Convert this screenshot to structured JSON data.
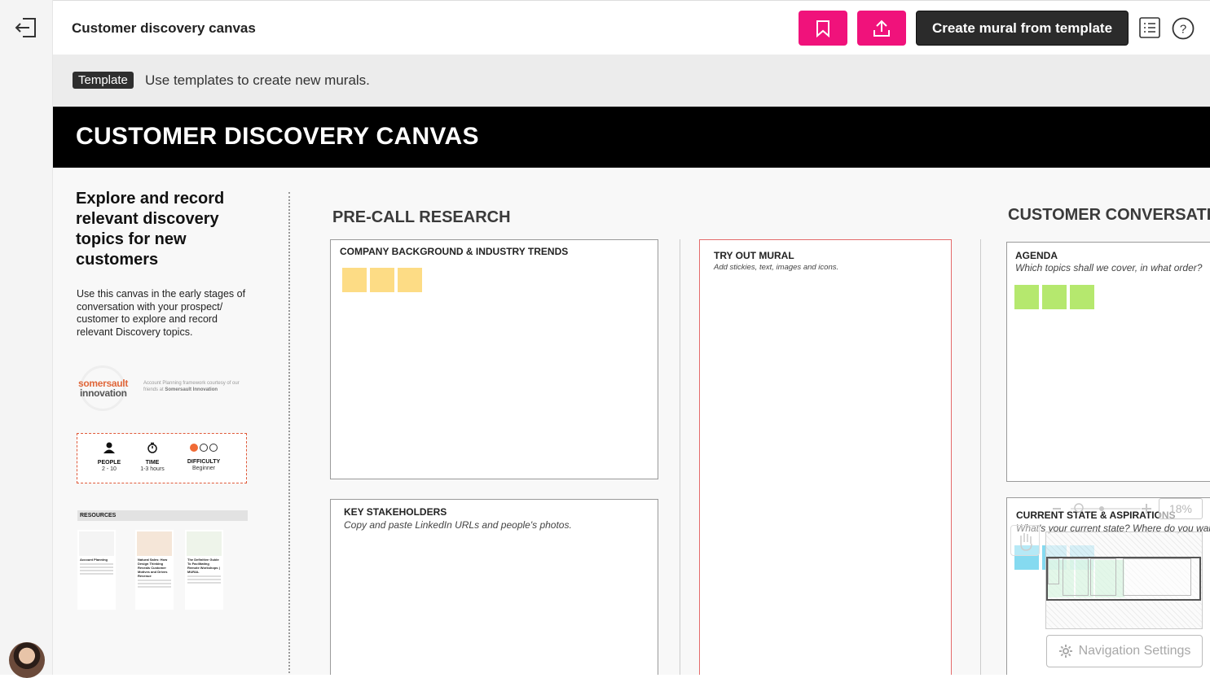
{
  "header": {
    "title": "Customer discovery canvas",
    "create_button": "Create mural from template",
    "accent_color": "#f0127b"
  },
  "banner": {
    "badge": "Template",
    "text": "Use templates to create new murals."
  },
  "canvas": {
    "title": "CUSTOMER DISCOVERY CANVAS",
    "intro_heading": "Explore and record relevant discovery topics for new customers",
    "intro_body": "Use this canvas in the early stages of conversation with your prospect/ customer to explore and record relevant Discovery topics.",
    "logo": {
      "word1": "somersault",
      "word2": "innovation"
    },
    "logo_credit": {
      "text": "Account Planning framework courtesy of our friends at",
      "bold": "Somersault Innovation"
    },
    "meta": {
      "people": {
        "label": "PEOPLE",
        "value": "2 - 10"
      },
      "time": {
        "label": "TIME",
        "value": "1-3 hours"
      },
      "difficulty": {
        "label": "DIFFICULTY",
        "value": "Beginner"
      }
    },
    "resources": {
      "label": "RESOURCES",
      "items": [
        {
          "title": "Account Planning"
        },
        {
          "title": "Natural Sales: How Design Thinking Reveals Customer Motives and Drives Revenue"
        },
        {
          "title": "The Definitive Guide To Facilitating Remote Workshops | MURAL"
        }
      ]
    },
    "sections": {
      "precall": "PRE-CALL RESEARCH",
      "conversation": "CUSTOMER  CONVERSATION"
    },
    "panels": {
      "company": {
        "title": "COMPANY BACKGROUND & INDUSTRY TRENDS"
      },
      "stakeholders": {
        "title": "KEY STAKEHOLDERS",
        "subtitle": "Copy and paste LinkedIn URLs and people's photos."
      },
      "tryout": {
        "title": "TRY OUT MURAL",
        "subtitle": "Add stickies, text, images and icons."
      },
      "agenda": {
        "title": "AGENDA",
        "subtitle": "Which topics shall we cover, in what order?"
      },
      "current": {
        "title": "CURRENT STATE & ASPIRATIONS",
        "subtitle": "What's your current state? Where do you want to be?"
      }
    }
  },
  "navigation": {
    "zoom": "18%",
    "settings_label": "Navigation Settings"
  }
}
